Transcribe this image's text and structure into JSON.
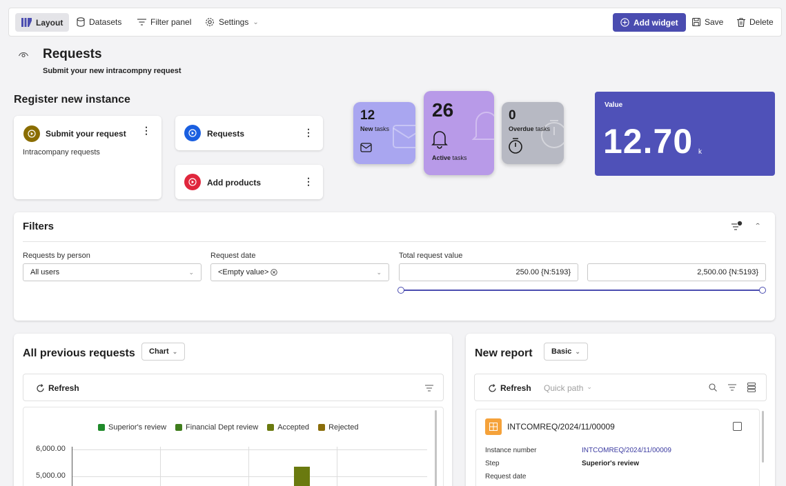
{
  "toolbar": {
    "layout_label": "Layout",
    "datasets_label": "Datasets",
    "filter_panel_label": "Filter panel",
    "settings_label": "Settings",
    "add_widget_label": "Add widget",
    "save_label": "Save",
    "delete_label": "Delete"
  },
  "header": {
    "title": "Requests",
    "subtitle": "Submit your new intracompny request"
  },
  "register": {
    "title": "Register new instance",
    "processes": [
      {
        "name": "Submit your request",
        "description": "Intracompany requests",
        "color": "#8a6d00"
      },
      {
        "name": "Requests",
        "color": "#1a5fe0"
      },
      {
        "name": "Add products",
        "color": "#e0273d"
      }
    ]
  },
  "tiles": {
    "new_tasks": {
      "count": "12",
      "label": "New",
      "label_suffix": "tasks",
      "color": "#a9a6f0"
    },
    "active_tasks": {
      "count": "26",
      "label": "Active",
      "label_suffix": "tasks",
      "color": "#b89ae8"
    },
    "overdue_tasks": {
      "count": "0",
      "label": "Overdue",
      "label_suffix": "tasks",
      "color": "#b7b9c3"
    }
  },
  "value_card": {
    "label": "Value",
    "value": "12.70",
    "unit": "k",
    "color": "#4f51b8"
  },
  "filters": {
    "title": "Filters",
    "requests_by_person": {
      "label": "Requests by person",
      "value": "All users"
    },
    "request_date": {
      "label": "Request date",
      "value": "<Empty value>"
    },
    "total_request_value": {
      "label": "Total request value",
      "min": "250.00 {N:5193}",
      "max": "2,500.00 {N:5193}"
    }
  },
  "previous_requests": {
    "title": "All previous requests",
    "view_label": "Chart",
    "refresh_label": "Refresh"
  },
  "chart_data": {
    "type": "bar",
    "legend": [
      {
        "name": "Superior's review",
        "color": "#1f8a2a"
      },
      {
        "name": "Financial Dept review",
        "color": "#3f7d1c"
      },
      {
        "name": "Accepted",
        "color": "#6a7a0f"
      },
      {
        "name": "Rejected",
        "color": "#8a6d0a"
      }
    ],
    "y_ticks": [
      "6,000.00",
      "5,000.00"
    ],
    "ylim_visible": [
      4600,
      6000
    ],
    "bars": [
      {
        "series": "Accepted",
        "value": 5350
      }
    ],
    "grid": true,
    "legend_position": "top"
  },
  "report": {
    "title": "New report",
    "view_label": "Basic",
    "refresh_label": "Refresh",
    "quick_path_label": "Quick path",
    "item": {
      "id": "INTCOMREQ/2024/11/00009",
      "fields": [
        {
          "label": "Instance number",
          "value": "INTCOMREQ/2024/11/00009"
        },
        {
          "label": "Step",
          "value": "Superior's review"
        },
        {
          "label": "Request date",
          "value": ""
        }
      ]
    }
  }
}
